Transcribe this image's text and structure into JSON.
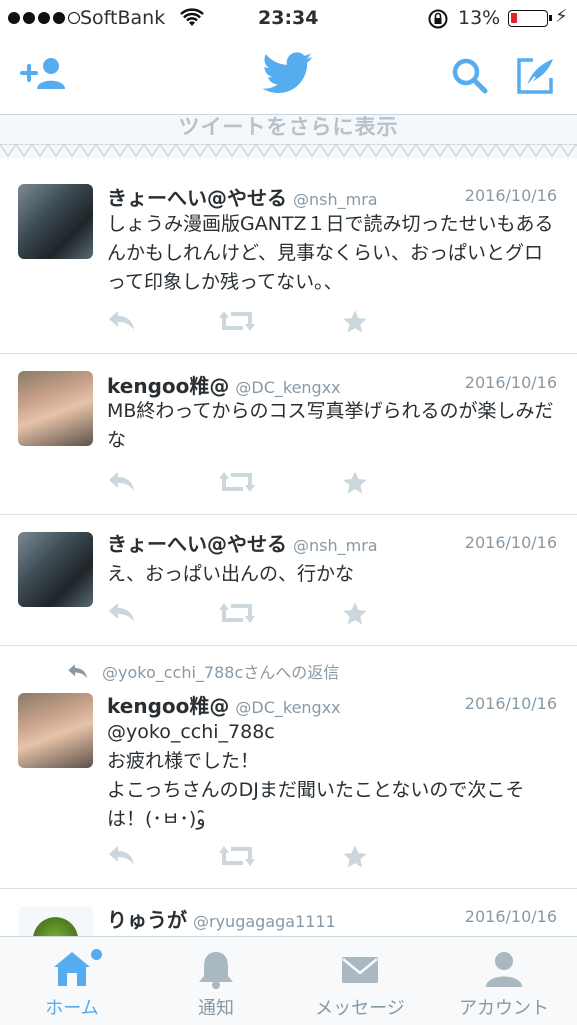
{
  "status_bar": {
    "carrier": "SoftBank",
    "time": "23:34",
    "battery_percent": "13%",
    "signal_bars": 4,
    "battery_level": 0.13
  },
  "nav": {
    "icons": [
      "add-user-icon",
      "twitter-bird-icon",
      "search-icon",
      "compose-icon"
    ],
    "accent_color": "#55acee"
  },
  "banner": {
    "more_tweets": "ツイートをさらに表示"
  },
  "tweets": [
    {
      "name": "きょーへい@やせる",
      "handle": "@nsh_mra",
      "date": "2016/10/16",
      "text": "しょうみ漫画版GANTZ１日で読み切ったせいもあるんかもしれんけど、見事なくらい、おっぱいとグロって印象しか残ってない。、"
    },
    {
      "name": "kengoo䊒@",
      "handle": "@DC_kengxx",
      "date": "2016/10/16",
      "text": "MB終わってからのコス写真挙げられるのが楽しみだな"
    },
    {
      "name": "きょーへい@やせる",
      "handle": "@nsh_mra",
      "date": "2016/10/16",
      "text": "え、おっぱい出んの、行かな"
    },
    {
      "reply_context": "@yoko_cchi_788cさんへの返信",
      "name": "kengoo䊒@",
      "handle": "@DC_kengxx",
      "date": "2016/10/16",
      "text": "@yoko_cchi_788c\nお疲れ様でした！\nよこっちさんのDJまだ聞いたことないので次こそは！(･ㅂ･)و ̑̑"
    },
    {
      "name": "りゅうが",
      "handle": "@ryugagaga1111",
      "date": "2016/10/16",
      "text": ""
    }
  ],
  "tabbar": {
    "tabs": [
      {
        "label": "ホーム",
        "icon": "home-icon",
        "active": true
      },
      {
        "label": "通知",
        "icon": "bell-icon",
        "active": false
      },
      {
        "label": "メッセージ",
        "icon": "envelope-icon",
        "active": false
      },
      {
        "label": "アカウント",
        "icon": "person-icon",
        "active": false
      }
    ]
  }
}
